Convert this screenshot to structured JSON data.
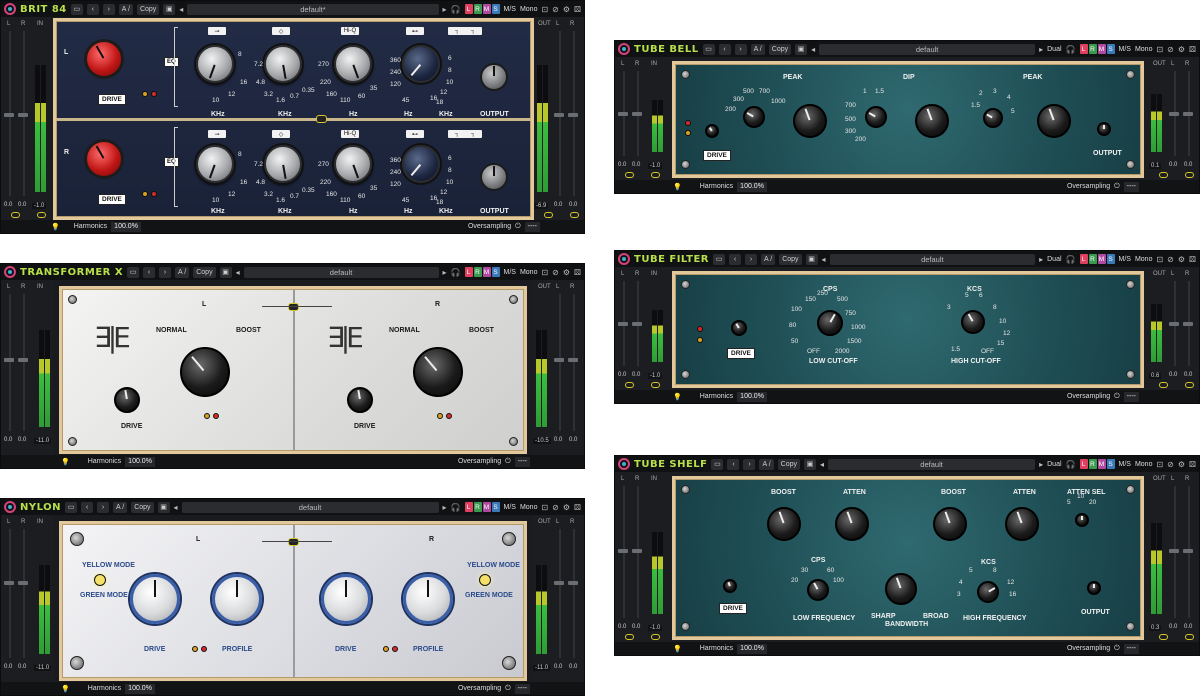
{
  "common": {
    "copy_label": "Copy",
    "ab_label": "A /",
    "ms_label": "M/S",
    "mono_label": "Mono",
    "dual_label": "Dual",
    "lrms": [
      "L",
      "R",
      "M",
      "S"
    ],
    "harmonics_label": "Harmonics",
    "harmonics_value": "100.0%",
    "oversampling_label": "Oversampling",
    "oversampling_value": "----",
    "icons": {
      "logo": "circle-logo",
      "folder": "folder-icon",
      "undo": "undo-icon",
      "redo": "redo-icon",
      "save": "save-icon",
      "prev": "arrow-left",
      "next": "arrow-right",
      "headphones": "headphones-icon",
      "compare": "compare-icon",
      "bypass": "bypass-icon",
      "settings": "gear-icon",
      "menu": "dice-icon",
      "help": "lightbulb-icon",
      "power": "power-icon",
      "link": "link-icon"
    },
    "sidebar": {
      "l": "L",
      "r": "R",
      "in": "IN",
      "out": "OUT"
    }
  },
  "brit84": {
    "title": "BRIT 84",
    "preset": "default*",
    "eq_label": "EQ",
    "drive_label": "DRIVE",
    "output_label": "OUTPUT",
    "channels": [
      "L",
      "R"
    ],
    "band_units": [
      "KHz",
      "KHz",
      "Hz",
      "Hz",
      "KHz"
    ],
    "filter_icons": [
      "⊸",
      "◇",
      "Hi-Q",
      "⊷",
      "┐",
      "┐"
    ],
    "knob_scales": {
      "k1": [
        "10",
        "12",
        "16",
        "8"
      ],
      "k2": [
        "7.2",
        "4.8",
        "3.2",
        "1.6",
        "0.7",
        "0.35"
      ],
      "k3": [
        "270",
        "220",
        "160",
        "110",
        "60",
        "35"
      ],
      "k4": [
        "360",
        "240",
        "120",
        "45"
      ],
      "k5": [
        "6",
        "8",
        "10",
        "12",
        "16",
        "18"
      ]
    },
    "in_readout": [
      "0.0",
      "0.0"
    ],
    "in_value": "-1.0",
    "out_value": "-6.9",
    "out_readout": [
      "0.0",
      "0.0"
    ]
  },
  "transformer": {
    "title": "TRANSFORMER X",
    "preset": "default",
    "channels": [
      "L",
      "R"
    ],
    "normal_label": "NORMAL",
    "boost_label": "BOOST",
    "drive_label": "DRIVE",
    "in_readout": [
      "0.0",
      "0.0"
    ],
    "in_value": "-11.0",
    "out_value": "-10.5",
    "out_readout": [
      "0.0",
      "0.0"
    ]
  },
  "nylon": {
    "title": "NYLON",
    "preset": "default",
    "channels": [
      "L",
      "R"
    ],
    "yellow_mode": "YELLOW MODE",
    "green_mode": "GREEN MODE",
    "drive_label": "DRIVE",
    "profile_label": "PROFILE",
    "in_readout": [
      "0.0",
      "0.0"
    ],
    "in_value": "-11.0",
    "out_value": "-11.0",
    "out_readout": [
      "0.0",
      "0.0"
    ]
  },
  "tubebell": {
    "title": "TUBE BELL",
    "preset": "default",
    "peak1": "PEAK",
    "dip": "DIP",
    "peak2": "PEAK",
    "drive_label": "DRIVE",
    "output_label": "OUTPUT",
    "freq_scale_a": [
      "200",
      "300",
      "500",
      "700",
      "1000"
    ],
    "freq_scale_b": [
      "700",
      "500",
      "300",
      "200",
      "1.5",
      "1"
    ],
    "freq_scale_c": [
      "1.5",
      "2",
      "3",
      "4",
      "5"
    ],
    "in_readout": [
      "0.0",
      "0.0"
    ],
    "in_value": "-1.0",
    "out_value": "0.1",
    "out_readout": [
      "0.0",
      "0.0"
    ]
  },
  "tubefilter": {
    "title": "TUBE FILTER",
    "preset": "default",
    "cps_label": "CPS",
    "kcs_label": "KCS",
    "low_cut_label": "LOW CUT-OFF",
    "high_cut_label": "HIGH CUT-OFF",
    "drive_label": "DRIVE",
    "cps_scale": [
      "150",
      "250",
      "500",
      "100",
      "750",
      "80",
      "1000",
      "50",
      "1500",
      "OFF",
      "2000"
    ],
    "kcs_scale": [
      "5",
      "6",
      "3",
      "8",
      "10",
      "12",
      "1.5",
      "15",
      "OFF"
    ],
    "in_readout": [
      "0.0",
      "0.0"
    ],
    "in_value": "-1.0",
    "out_value": "0.6",
    "out_readout": [
      "0.0",
      "0.0"
    ]
  },
  "tubeshelf": {
    "title": "TUBE SHELF",
    "preset": "default",
    "boost1": "BOOST",
    "atten1": "ATTEN",
    "boost2": "BOOST",
    "atten2": "ATTEN",
    "atten_sel": "ATTEN SEL",
    "atten_sel_values": [
      "5",
      "10",
      "20"
    ],
    "cps_label": "CPS",
    "cps_values": [
      "30",
      "60",
      "20",
      "100"
    ],
    "kcs_label": "KCS",
    "kcs_values": [
      "5",
      "8",
      "4",
      "12",
      "3",
      "16"
    ],
    "drive_label": "DRIVE",
    "low_freq": "LOW FREQUENCY",
    "bandwidth": "BANDWIDTH",
    "sharp": "SHARP",
    "broad": "BROAD",
    "high_freq": "HIGH FREQUENCY",
    "output_label": "OUTPUT",
    "in_readout": [
      "0.0",
      "0.0"
    ],
    "in_value": "-1.0",
    "out_value": "0.3",
    "out_readout": [
      "0.0",
      "0.0"
    ]
  }
}
